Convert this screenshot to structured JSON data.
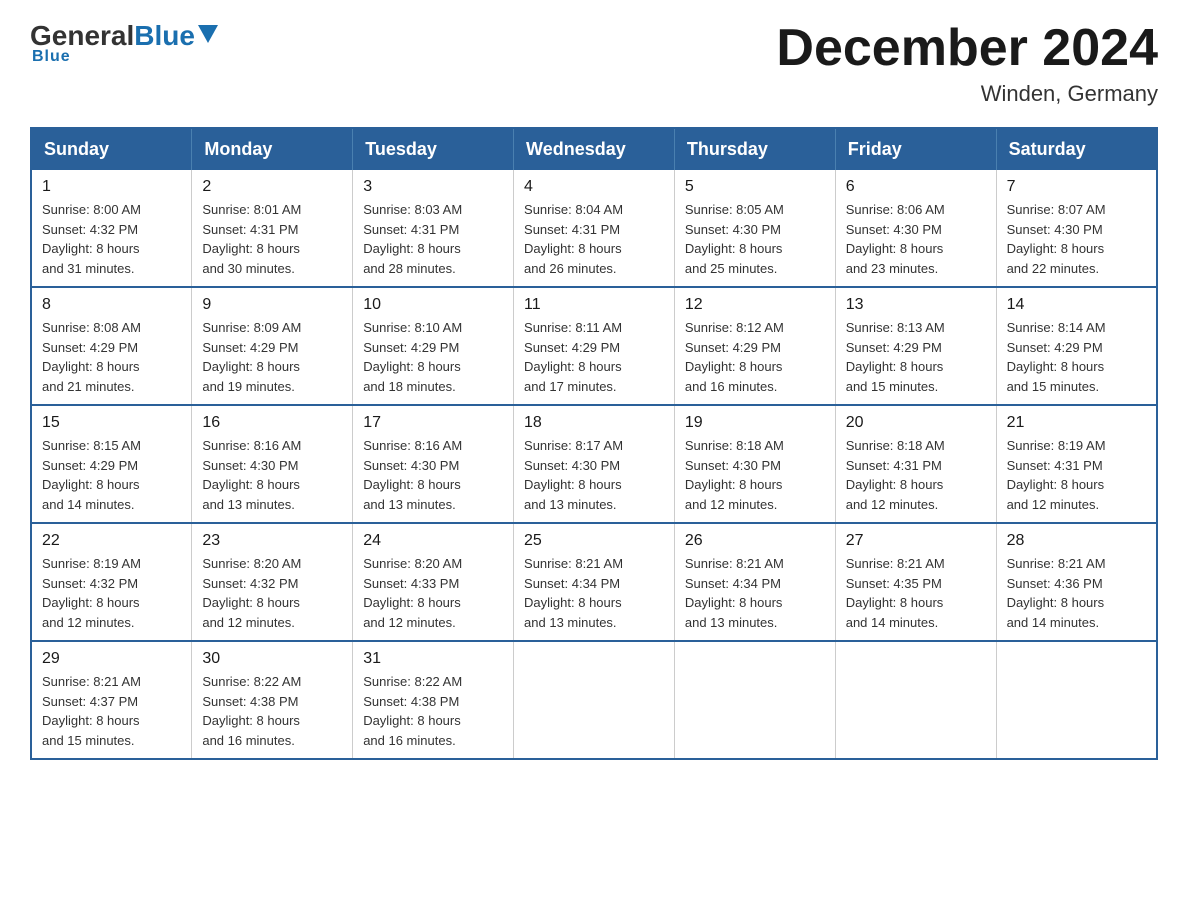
{
  "header": {
    "logo": {
      "general": "General",
      "blue": "Blue",
      "underline": "Blue"
    },
    "title": "December 2024",
    "location": "Winden, Germany"
  },
  "days_of_week": [
    "Sunday",
    "Monday",
    "Tuesday",
    "Wednesday",
    "Thursday",
    "Friday",
    "Saturday"
  ],
  "weeks": [
    [
      {
        "day": "1",
        "sunrise": "8:00 AM",
        "sunset": "4:32 PM",
        "daylight": "8 hours and 31 minutes."
      },
      {
        "day": "2",
        "sunrise": "8:01 AM",
        "sunset": "4:31 PM",
        "daylight": "8 hours and 30 minutes."
      },
      {
        "day": "3",
        "sunrise": "8:03 AM",
        "sunset": "4:31 PM",
        "daylight": "8 hours and 28 minutes."
      },
      {
        "day": "4",
        "sunrise": "8:04 AM",
        "sunset": "4:31 PM",
        "daylight": "8 hours and 26 minutes."
      },
      {
        "day": "5",
        "sunrise": "8:05 AM",
        "sunset": "4:30 PM",
        "daylight": "8 hours and 25 minutes."
      },
      {
        "day": "6",
        "sunrise": "8:06 AM",
        "sunset": "4:30 PM",
        "daylight": "8 hours and 23 minutes."
      },
      {
        "day": "7",
        "sunrise": "8:07 AM",
        "sunset": "4:30 PM",
        "daylight": "8 hours and 22 minutes."
      }
    ],
    [
      {
        "day": "8",
        "sunrise": "8:08 AM",
        "sunset": "4:29 PM",
        "daylight": "8 hours and 21 minutes."
      },
      {
        "day": "9",
        "sunrise": "8:09 AM",
        "sunset": "4:29 PM",
        "daylight": "8 hours and 19 minutes."
      },
      {
        "day": "10",
        "sunrise": "8:10 AM",
        "sunset": "4:29 PM",
        "daylight": "8 hours and 18 minutes."
      },
      {
        "day": "11",
        "sunrise": "8:11 AM",
        "sunset": "4:29 PM",
        "daylight": "8 hours and 17 minutes."
      },
      {
        "day": "12",
        "sunrise": "8:12 AM",
        "sunset": "4:29 PM",
        "daylight": "8 hours and 16 minutes."
      },
      {
        "day": "13",
        "sunrise": "8:13 AM",
        "sunset": "4:29 PM",
        "daylight": "8 hours and 15 minutes."
      },
      {
        "day": "14",
        "sunrise": "8:14 AM",
        "sunset": "4:29 PM",
        "daylight": "8 hours and 15 minutes."
      }
    ],
    [
      {
        "day": "15",
        "sunrise": "8:15 AM",
        "sunset": "4:29 PM",
        "daylight": "8 hours and 14 minutes."
      },
      {
        "day": "16",
        "sunrise": "8:16 AM",
        "sunset": "4:30 PM",
        "daylight": "8 hours and 13 minutes."
      },
      {
        "day": "17",
        "sunrise": "8:16 AM",
        "sunset": "4:30 PM",
        "daylight": "8 hours and 13 minutes."
      },
      {
        "day": "18",
        "sunrise": "8:17 AM",
        "sunset": "4:30 PM",
        "daylight": "8 hours and 13 minutes."
      },
      {
        "day": "19",
        "sunrise": "8:18 AM",
        "sunset": "4:30 PM",
        "daylight": "8 hours and 12 minutes."
      },
      {
        "day": "20",
        "sunrise": "8:18 AM",
        "sunset": "4:31 PM",
        "daylight": "8 hours and 12 minutes."
      },
      {
        "day": "21",
        "sunrise": "8:19 AM",
        "sunset": "4:31 PM",
        "daylight": "8 hours and 12 minutes."
      }
    ],
    [
      {
        "day": "22",
        "sunrise": "8:19 AM",
        "sunset": "4:32 PM",
        "daylight": "8 hours and 12 minutes."
      },
      {
        "day": "23",
        "sunrise": "8:20 AM",
        "sunset": "4:32 PM",
        "daylight": "8 hours and 12 minutes."
      },
      {
        "day": "24",
        "sunrise": "8:20 AM",
        "sunset": "4:33 PM",
        "daylight": "8 hours and 12 minutes."
      },
      {
        "day": "25",
        "sunrise": "8:21 AM",
        "sunset": "4:34 PM",
        "daylight": "8 hours and 13 minutes."
      },
      {
        "day": "26",
        "sunrise": "8:21 AM",
        "sunset": "4:34 PM",
        "daylight": "8 hours and 13 minutes."
      },
      {
        "day": "27",
        "sunrise": "8:21 AM",
        "sunset": "4:35 PM",
        "daylight": "8 hours and 14 minutes."
      },
      {
        "day": "28",
        "sunrise": "8:21 AM",
        "sunset": "4:36 PM",
        "daylight": "8 hours and 14 minutes."
      }
    ],
    [
      {
        "day": "29",
        "sunrise": "8:21 AM",
        "sunset": "4:37 PM",
        "daylight": "8 hours and 15 minutes."
      },
      {
        "day": "30",
        "sunrise": "8:22 AM",
        "sunset": "4:38 PM",
        "daylight": "8 hours and 16 minutes."
      },
      {
        "day": "31",
        "sunrise": "8:22 AM",
        "sunset": "4:38 PM",
        "daylight": "8 hours and 16 minutes."
      },
      null,
      null,
      null,
      null
    ]
  ],
  "labels": {
    "sunrise": "Sunrise:",
    "sunset": "Sunset:",
    "daylight": "Daylight:"
  }
}
